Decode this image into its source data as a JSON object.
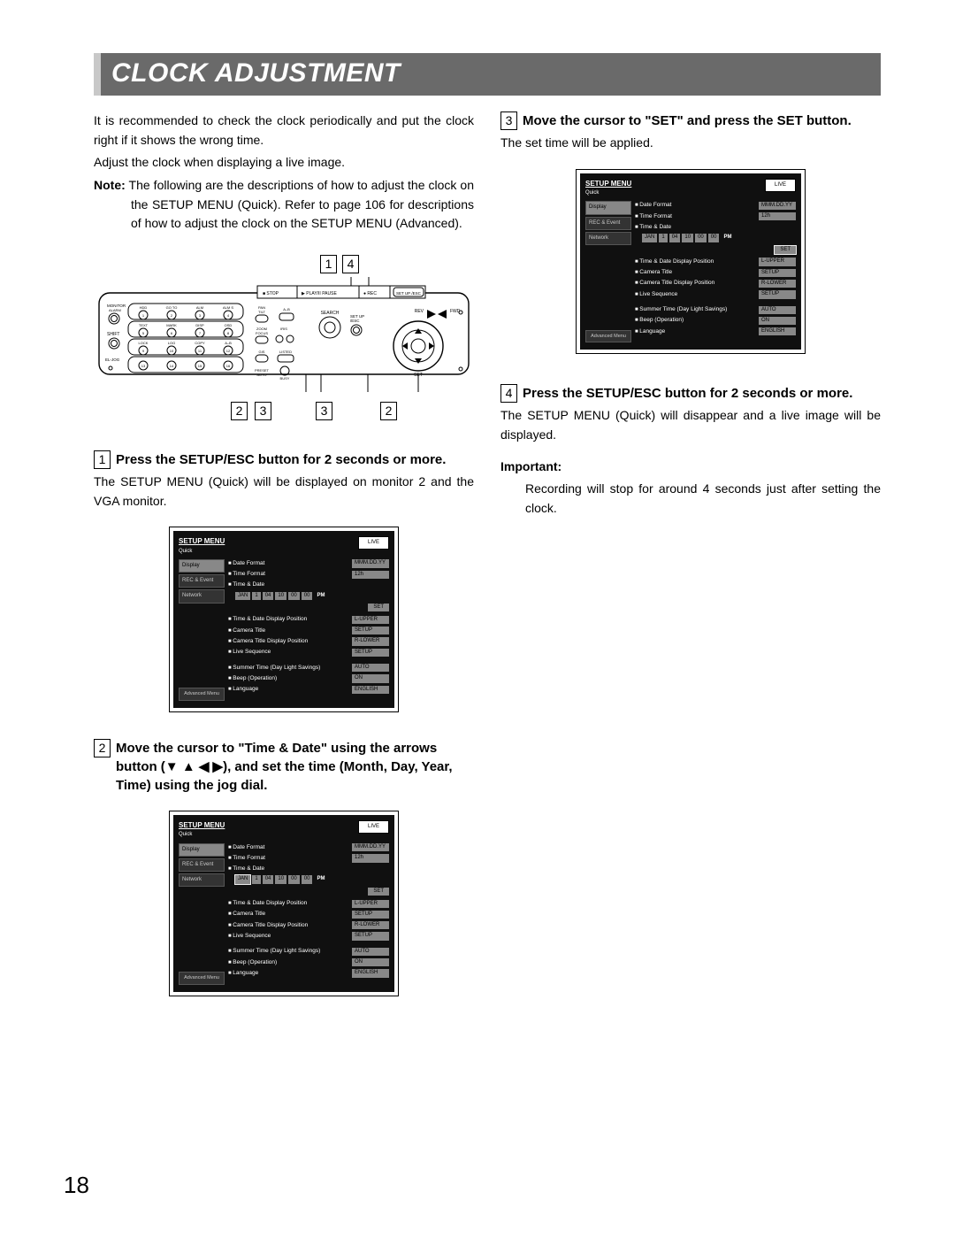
{
  "page_number": "18",
  "title": "CLOCK ADJUSTMENT",
  "intro_p1": "It is recommended to check the clock periodically and put the clock right if it shows the wrong time.",
  "intro_p2": "Adjust the clock when displaying a live image.",
  "note_label": "Note:",
  "note_body": "The following are the descriptions of how to adjust the clock on the SETUP MENU (Quick). Refer to page 106 for descriptions of how to adjust the clock on the SETUP MENU (Advanced).",
  "callouts": {
    "top1": "1",
    "top2": "4",
    "b1": "2",
    "b2": "3",
    "b3": "3",
    "b4": "2"
  },
  "device": {
    "labels": {
      "stop": "■ STOP",
      "play": "▶ PLAY/II PAUSE",
      "rec": "● REC",
      "setup": "SET UP /ESC",
      "rev": "REV",
      "fwd": "FWD",
      "search": "SEARCH",
      "set": "SET",
      "busy": "BUSY",
      "monitor": "MONITOR ALARM",
      "shift": "SHIFT",
      "eljog": "EL-JOG",
      "pan": "PAN TILT",
      "zoom": "ZOOM FOCUS",
      "iris": "IRIS",
      "preset": "PRESET AUTO",
      "listed": "LISTED",
      "hdd": "HDD",
      "go": "GO TO LAST",
      "alm": "ALM RESET",
      "alms": "ALM SUSPEND",
      "text": "TEXT",
      "mark": "MARK",
      "disp": "DISP SELECT",
      "osd": "OSD",
      "lock": "LOCK",
      "logout": "LOG OUT",
      "copy": "COPY",
      "ab": "A–B REPEAT"
    },
    "nums": [
      "1",
      "2",
      "3",
      "4",
      "5",
      "6",
      "7",
      "8",
      "9",
      "10",
      "11",
      "12",
      "13",
      "14",
      "15",
      "16"
    ]
  },
  "steps": {
    "s1": {
      "num": "1",
      "head": "Press the SETUP/ESC button for 2 seconds or more.",
      "body": "The SETUP MENU (Quick) will be displayed on monitor 2 and the VGA monitor."
    },
    "s2": {
      "num": "2",
      "head": "Move the cursor to \"Time & Date\" using the arrows button (▼ ▲ ◀ ▶), and set the time (Month, Day, Year, Time) using the jog dial."
    },
    "s3": {
      "num": "3",
      "head": "Move the cursor to \"SET\" and press the SET button.",
      "body": "The set time will be applied."
    },
    "s4": {
      "num": "4",
      "head": "Press the SETUP/ESC button for 2 seconds or more.",
      "body": "The SETUP MENU (Quick) will disappear and a live image will be displayed."
    }
  },
  "important": {
    "label": "Important:",
    "body": "Recording will stop for around 4 seconds just after setting the clock."
  },
  "setup_menu": {
    "title": "SETUP MENU",
    "subtitle": "Quick",
    "live": "LIVE",
    "tabs": {
      "display": "Display",
      "rec": "REC & Event",
      "network": "Network",
      "advanced": "Advanced Menu"
    },
    "rows": {
      "date_format": {
        "lbl": "Date Format",
        "val": "MMM.DD.YY"
      },
      "time_format": {
        "lbl": "Time Format",
        "val": "12h"
      },
      "time_date": {
        "lbl": "Time & Date"
      },
      "td_pos": {
        "lbl": "Time & Date Display Position",
        "val": "L-UPPER"
      },
      "cam_title": {
        "lbl": "Camera Title",
        "val": "SETUP"
      },
      "cam_title_pos": {
        "lbl": "Camera Title Display Position",
        "val": "R-LOWER"
      },
      "live_seq": {
        "lbl": "Live Sequence",
        "val": "SETUP"
      },
      "summer": {
        "lbl": "Summer Time (Day Light Savings)",
        "val": "AUTO"
      },
      "beep": {
        "lbl": "Beep (Operation)",
        "val": "ON"
      },
      "lang": {
        "lbl": "Language",
        "val": "ENGLISH"
      }
    },
    "date_cells": {
      "mon": "JAN",
      "day": "1",
      "yr": "04",
      "h": "10",
      "m": "00",
      "s": "00",
      "ampm": "PM",
      "set": "SET"
    }
  }
}
